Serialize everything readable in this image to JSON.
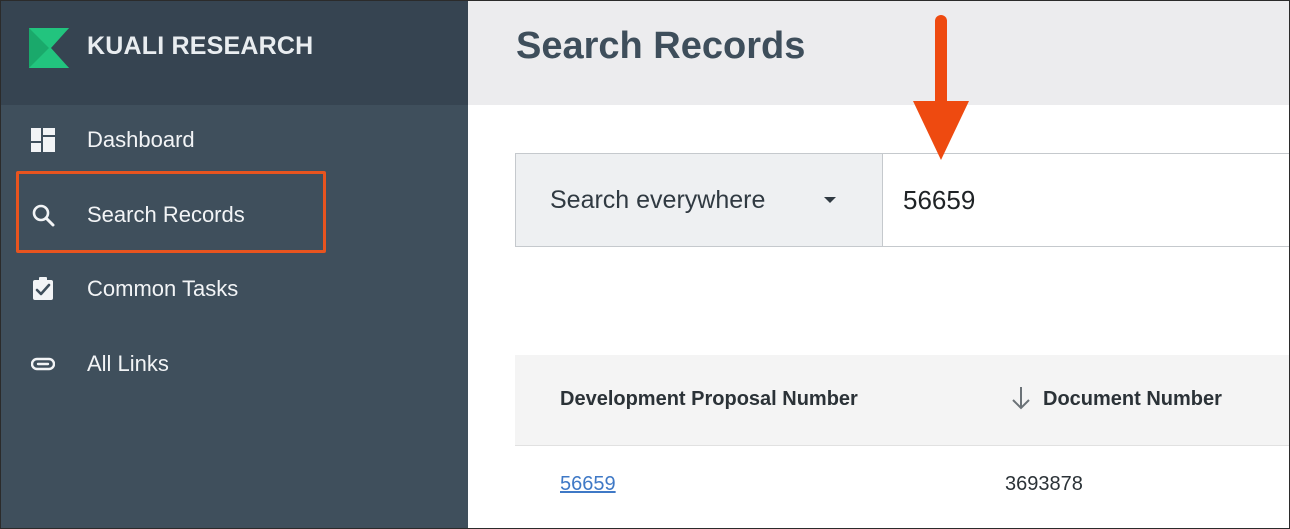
{
  "brand": {
    "name": "KUALI RESEARCH",
    "logo_color": "#22c47e"
  },
  "sidebar": {
    "items": [
      {
        "label": "Dashboard",
        "icon": "dashboard-icon"
      },
      {
        "label": "Search Records",
        "icon": "search-icon",
        "active": true
      },
      {
        "label": "Common Tasks",
        "icon": "clipboard-check-icon"
      },
      {
        "label": "All Links",
        "icon": "link-icon"
      }
    ],
    "highlight_color": "#e8541f"
  },
  "header": {
    "title": "Search Records"
  },
  "search": {
    "scope_label": "Search everywhere",
    "query": "56659"
  },
  "annotation": {
    "arrow_color": "#ee4a10"
  },
  "table": {
    "columns": [
      "Development Proposal Number",
      "Document Number"
    ],
    "sorted_column": "Document Number",
    "sort_direction": "descending",
    "rows": [
      [
        "56659",
        "3693878"
      ]
    ]
  }
}
